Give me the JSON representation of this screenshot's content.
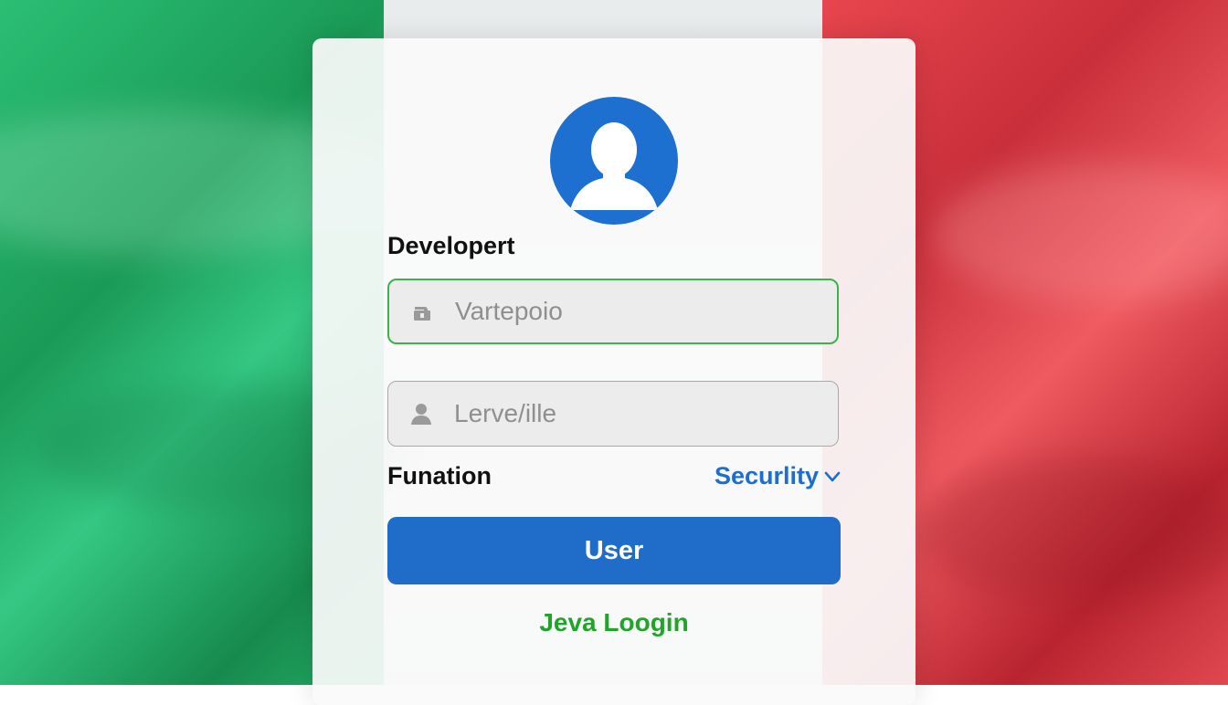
{
  "background": {
    "flag_colors": [
      "#2bbf74",
      "#f4f5f5",
      "#e8464e"
    ]
  },
  "login": {
    "avatar_icon": "user-avatar-icon",
    "heading": "Developert",
    "field1": {
      "icon": "lock-icon",
      "placeholder": "Vartepoio",
      "value": ""
    },
    "field2": {
      "icon": "user-icon",
      "placeholder": "Lerve/ille",
      "value": ""
    },
    "left_label": "Funation",
    "security_link": "Securlity",
    "security_icon": "chevron-down-icon",
    "submit_label": "User",
    "footer_link": "Jeva Loogin",
    "colors": {
      "primary": "#1f6dc9",
      "accent_green": "#22a32a",
      "focus_border": "#3cb34a"
    }
  }
}
